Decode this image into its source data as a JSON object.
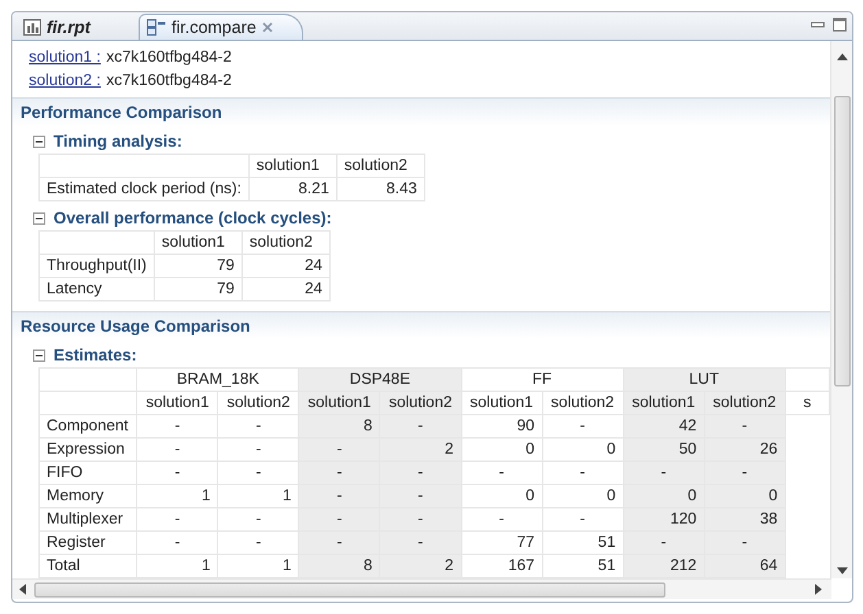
{
  "tabs": [
    {
      "label": "fir.rpt",
      "selected": false,
      "closable": false
    },
    {
      "label": "fir.compare",
      "selected": true,
      "closable": true
    }
  ],
  "targets": [
    {
      "link": "solution1 :",
      "value": "xc7k160tfbg484-2"
    },
    {
      "link": "solution2 :",
      "value": "xc7k160tfbg484-2"
    }
  ],
  "sections": [
    {
      "title": "Performance Comparison",
      "subsections": [
        {
          "title": "Timing analysis:",
          "expanded": true,
          "table": {
            "columns": [
              "",
              "solution1",
              "solution2"
            ],
            "rows": [
              [
                "Estimated clock period (ns):",
                "8.21",
                "8.43"
              ]
            ]
          }
        },
        {
          "title": "Overall performance (clock cycles):",
          "expanded": true,
          "table": {
            "columns": [
              "",
              "solution1",
              "solution2"
            ],
            "rows": [
              [
                "Throughput(II)",
                "79",
                "24"
              ],
              [
                "Latency",
                "79",
                "24"
              ]
            ]
          }
        }
      ]
    },
    {
      "title": "Resource Usage Comparison",
      "subsections": [
        {
          "title": "Estimates:",
          "expanded": true,
          "grouped_table": {
            "groups": [
              {
                "label": "BRAM_18K",
                "shaded": false,
                "columns": [
                  "solution1",
                  "solution2"
                ]
              },
              {
                "label": "DSP48E",
                "shaded": true,
                "columns": [
                  "solution1",
                  "solution2"
                ]
              },
              {
                "label": "FF",
                "shaded": false,
                "columns": [
                  "solution1",
                  "solution2"
                ]
              },
              {
                "label": "LUT",
                "shaded": true,
                "columns": [
                  "solution1",
                  "solution2"
                ]
              },
              {
                "shaded": false,
                "columns": [
                  "s"
                ]
              }
            ],
            "rows": [
              [
                "Component",
                "-",
                "-",
                "8",
                "-",
                "90",
                "-",
                "42",
                "-"
              ],
              [
                "Expression",
                "-",
                "-",
                "-",
                "2",
                "0",
                "0",
                "50",
                "26"
              ],
              [
                "FIFO",
                "-",
                "-",
                "-",
                "-",
                "-",
                "-",
                "-",
                "-"
              ],
              [
                "Memory",
                "1",
                "1",
                "-",
                "-",
                "0",
                "0",
                "0",
                "0"
              ],
              [
                "Multiplexer",
                "-",
                "-",
                "-",
                "-",
                "-",
                "-",
                "120",
                "38"
              ],
              [
                "Register",
                "-",
                "-",
                "-",
                "-",
                "77",
                "51",
                "-",
                "-"
              ],
              [
                "Total",
                "1",
                "1",
                "8",
                "2",
                "167",
                "51",
                "212",
                "64"
              ]
            ]
          }
        }
      ]
    }
  ]
}
